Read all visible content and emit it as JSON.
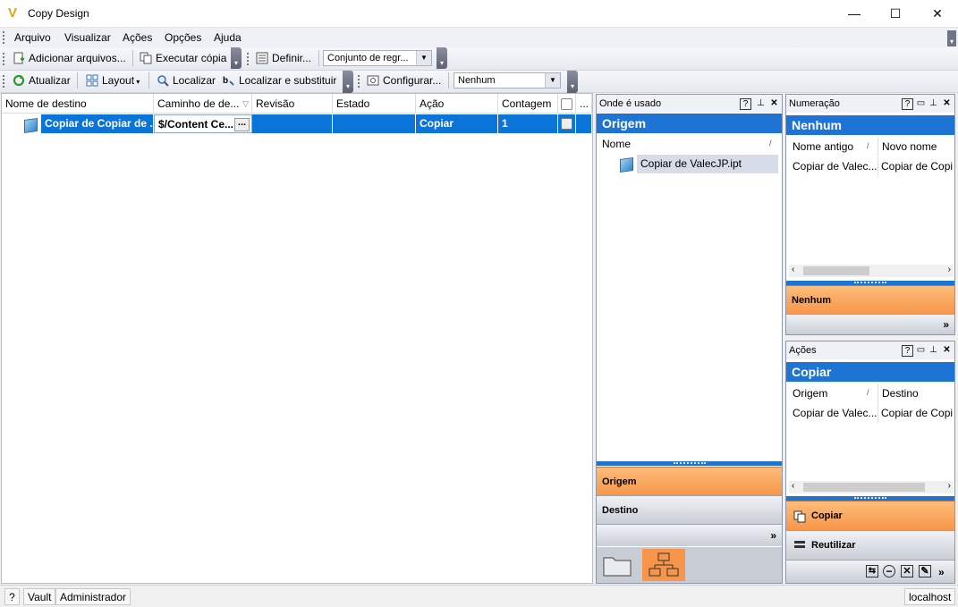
{
  "window": {
    "title": "Copy Design",
    "minimize": "—",
    "maximize": "☐",
    "close": "✕"
  },
  "menu": [
    "Arquivo",
    "Visualizar",
    "Ações",
    "Opções",
    "Ajuda"
  ],
  "toolbar1": {
    "add_files": "Adicionar arquivos...",
    "execute_copy": "Executar cópia",
    "define": "Definir...",
    "ruleset_combo": "Conjunto de regr..."
  },
  "toolbar2": {
    "refresh": "Atualizar",
    "layout": "Layout",
    "find": "Localizar",
    "find_replace": "Localizar e substituir",
    "configure": "Configurar...",
    "none_combo": "Nenhum"
  },
  "grid": {
    "columns": [
      "Nome de destino",
      "Caminho de de...",
      "Revisão",
      "Estado",
      "Ação",
      "Contagem",
      "",
      "..."
    ],
    "rows": [
      {
        "name": "Copiar de Copiar de ...",
        "path": "$/Content Ce...",
        "path_button": "...",
        "revision": "",
        "state": "",
        "action": "Copiar",
        "count": "1"
      }
    ]
  },
  "where_used": {
    "title": "Onde é usado",
    "header": "Origem",
    "column": "Nome",
    "item": "Copiar de ValecJP.ipt",
    "tab_active": "Origem",
    "tab_other": "Destino"
  },
  "numbering": {
    "title": "Numeração",
    "header": "Nenhum",
    "col_old": "Nome antigo",
    "col_new": "Novo nome",
    "row_old": "Copiar de Valec...",
    "row_new": "Copiar de Copi",
    "tab_active": "Nenhum"
  },
  "actions": {
    "title": "Ações",
    "header": "Copiar",
    "col_origin": "Origem",
    "col_dest": "Destino",
    "row_origin": "Copiar de Valec...",
    "row_dest": "Copiar de Copi",
    "tab_active": "Copiar",
    "tab_other": "Reutilizar"
  },
  "status": {
    "help": "?",
    "vault": "Vault",
    "user": "Administrador",
    "server": "localhost"
  },
  "colors": {
    "selection": "#0a74d9",
    "panel_title": "#1d74d5",
    "active_tab": "#f7964a"
  }
}
